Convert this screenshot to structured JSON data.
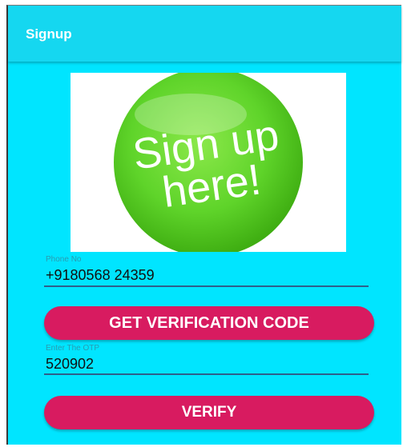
{
  "app": {
    "title": "Signup"
  },
  "hero": {
    "text_line1": "Sign up",
    "text_line2": "here!"
  },
  "phone": {
    "label": "Phone No",
    "value": "+9180568 24359"
  },
  "get_code_button": {
    "label": "GET VERIFICATION CODE"
  },
  "otp": {
    "label": "Enter The OTP",
    "value": "520902"
  },
  "verify_button": {
    "label": "VERIFY"
  },
  "colors": {
    "background": "#00e5ff",
    "button": "#d81b60",
    "hero_green": "#5fd42a"
  }
}
